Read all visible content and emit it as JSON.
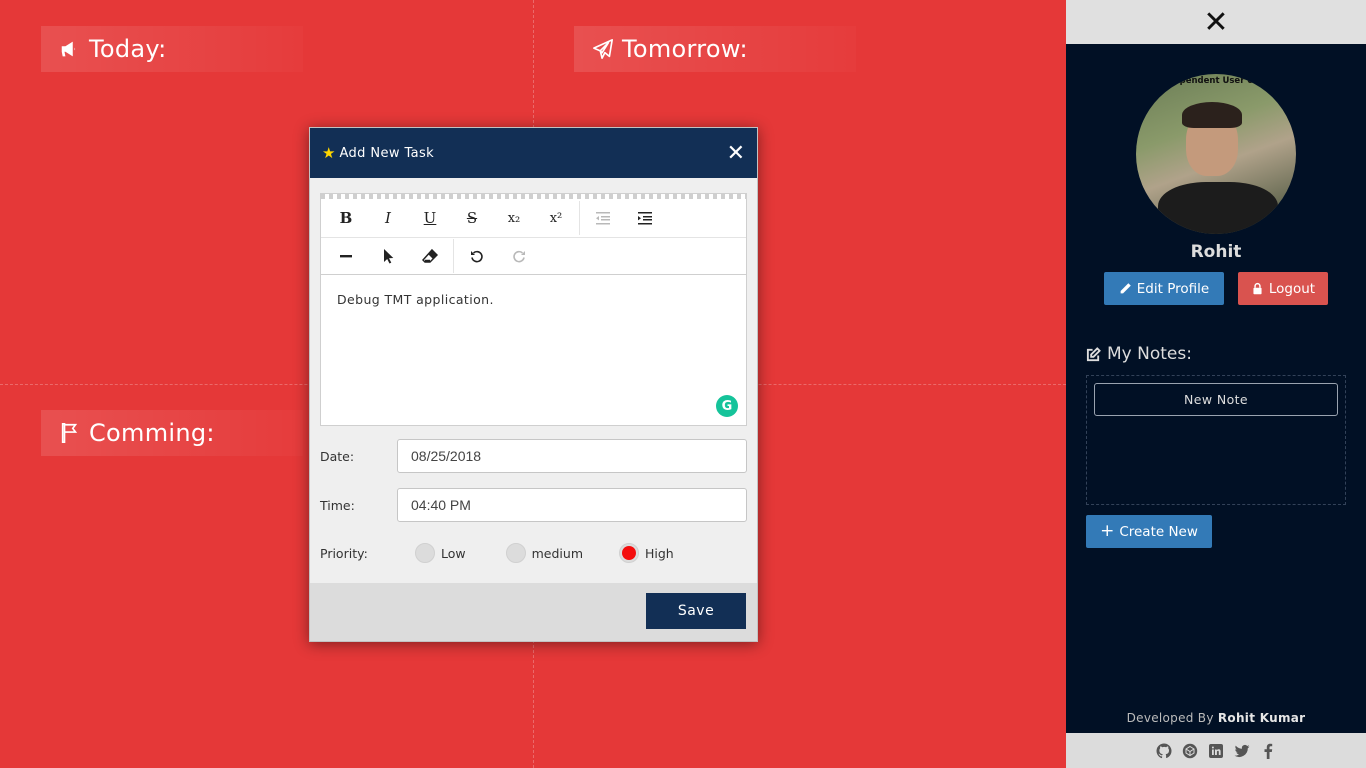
{
  "board": {
    "quadrants": {
      "today": "Today:",
      "tomorrow": "Tomorrow:",
      "coming": "Comming:"
    }
  },
  "modal": {
    "title": "Add New Task",
    "star_icon": "star-icon",
    "close_symbol": "✕",
    "editor": {
      "toolbar_row1": [
        "B",
        "I",
        "U",
        "S",
        "x₂",
        "x²"
      ],
      "content": "Debug TMT application.",
      "grammarly_glyph": "G"
    },
    "fields": {
      "date_label": "Date:",
      "date_value": "08/25/2018",
      "time_label": "Time:",
      "time_value": "04:40 PM",
      "priority_label": "Priority:",
      "priority_options": [
        "Low",
        "medium",
        "High"
      ],
      "priority_selected": "High"
    },
    "save_label": "Save"
  },
  "sidebar": {
    "close_symbol": "✕",
    "avatar_caption": "ependent User ca",
    "username": "Rohit",
    "edit_profile_label": "Edit Profile",
    "logout_label": "Logout",
    "notes_title": "My Notes:",
    "notes": [
      "New Note"
    ],
    "create_new_label": "Create New",
    "developed_by_prefix": "Developed By",
    "developer_name": "Rohit Kumar",
    "social_icons": [
      "github-icon",
      "codepen-icon",
      "linkedin-icon",
      "twitter-icon",
      "facebook-icon"
    ]
  },
  "colors": {
    "board_bg": "#e53838",
    "modal_header": "#122f55",
    "sidebar_bg": "#011025",
    "primary_button": "#337ab7",
    "danger_button": "#d9534f",
    "priority_high": "#f40d0d"
  }
}
